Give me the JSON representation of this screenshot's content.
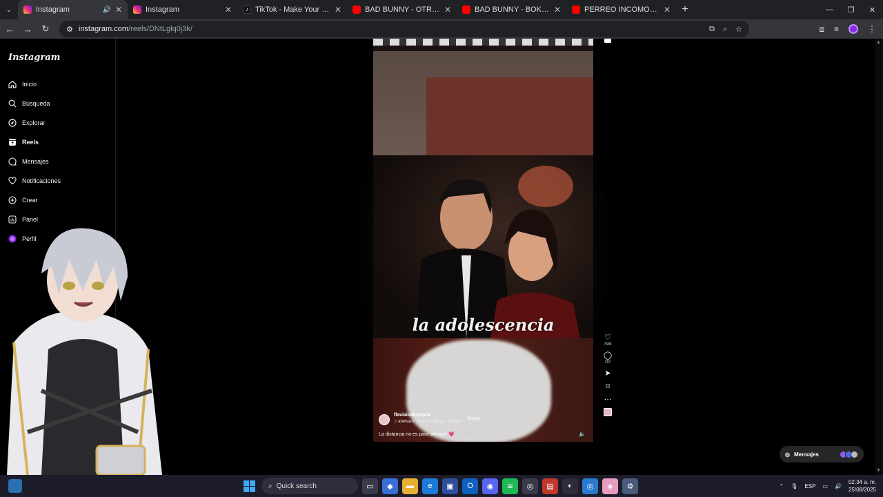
{
  "browser": {
    "tabs": [
      {
        "title": "Instagram",
        "favicon": "instagram-icon",
        "active": true,
        "audio": true
      },
      {
        "title": "Instagram",
        "favicon": "instagram-icon",
        "active": false
      },
      {
        "title": "TikTok - Make Your Day",
        "favicon": "tiktok-icon",
        "active": false
      },
      {
        "title": "BAD BUNNY - OTRA NOCHE EN",
        "favicon": "youtube-icon",
        "active": false
      },
      {
        "title": "BAD BUNNY - BOKeTE (Video C",
        "favicon": "youtube-icon",
        "active": false
      },
      {
        "title": "PERREO INCÓMODO (Al Volant",
        "favicon": "youtube-icon",
        "active": false
      }
    ],
    "url_host": "instagram.com",
    "url_path": "/reels/DNtLglq0j3k/"
  },
  "sidebar": {
    "logo": "Instagram",
    "items": [
      {
        "label": "Inicio",
        "icon": "home-icon"
      },
      {
        "label": "Búsqueda",
        "icon": "search-icon"
      },
      {
        "label": "Explorar",
        "icon": "compass-icon"
      },
      {
        "label": "Reels",
        "icon": "reels-icon",
        "active": true
      },
      {
        "label": "Mensajes",
        "icon": "messenger-icon"
      },
      {
        "label": "Notificaciones",
        "icon": "heart-icon"
      },
      {
        "label": "Crear",
        "icon": "plus-icon"
      },
      {
        "label": "Panel",
        "icon": "chart-icon"
      },
      {
        "label": "Perfil",
        "icon": "avatar-icon"
      }
    ]
  },
  "reel": {
    "caption_overlay": "la adolescencia",
    "username": "flaviaisabelsanz",
    "audio": "♫ abelsanz · Audio original",
    "audio_extra": "flaviais",
    "follow_label": "Seguir",
    "description": "La distancia no es para siempre 💗",
    "more_label": "... más",
    "likes": "7585",
    "comments": "297"
  },
  "messages_pill": {
    "label": "Mensajes"
  },
  "taskbar": {
    "search_placeholder": "Quick search",
    "language": "ESP",
    "time": "02:34 a. m.",
    "date": "25/08/2025"
  },
  "colors": {
    "accent": "#3fa9f5",
    "ig_gradient": "#ee2a7b",
    "profile": "#8a2be2"
  }
}
